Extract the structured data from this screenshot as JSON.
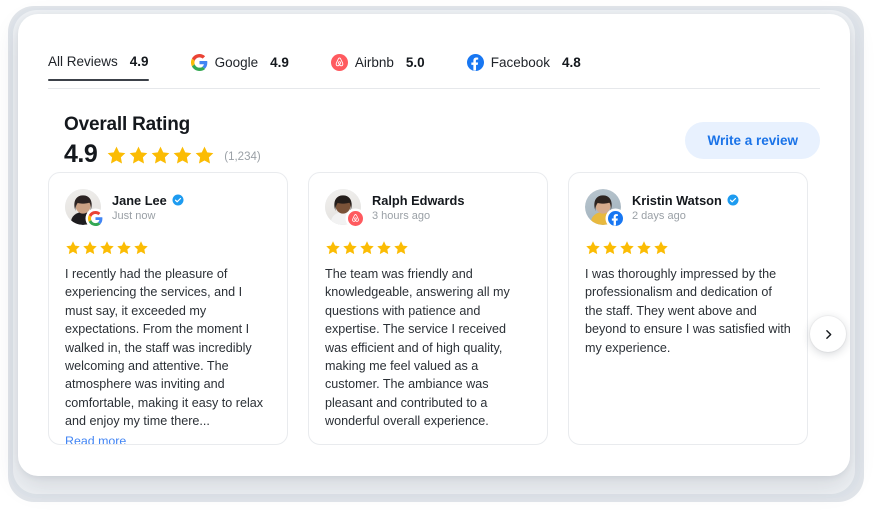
{
  "colors": {
    "accent_blue": "#1a73e8",
    "link_blue": "#4285f4",
    "star_gold": "#FBBC04",
    "airbnb_red": "#FF5A5F",
    "facebook_blue": "#1877F2",
    "verified_blue": "#1d9bf0",
    "panel_bg": "#ffffff",
    "card_border": "#e9ebee"
  },
  "tabs": [
    {
      "label": "All Reviews",
      "score": "4.9",
      "icon": "none",
      "active": true
    },
    {
      "label": "Google",
      "score": "4.9",
      "icon": "google-icon",
      "active": false
    },
    {
      "label": "Airbnb",
      "score": "5.0",
      "icon": "airbnb-icon",
      "active": false
    },
    {
      "label": "Facebook",
      "score": "4.8",
      "icon": "facebook-icon",
      "active": false
    }
  ],
  "overall": {
    "title": "Overall Rating",
    "score": "4.9",
    "stars": 5,
    "count": "(1,234)"
  },
  "write_review_button": "Write a review",
  "next_button_icon": "chevron-right-icon",
  "reviews": [
    {
      "name": "Jane Lee",
      "verified": true,
      "timestamp": "Just now",
      "source": "google-icon",
      "stars": 5,
      "text": "I recently had the pleasure of experiencing the services, and I must say, it exceeded my expectations. From the moment I walked in, the staff was incredibly welcoming and attentive. The atmosphere was inviting and comfortable, making it easy to relax and enjoy my time there...",
      "read_more": "Read more"
    },
    {
      "name": "Ralph Edwards",
      "verified": false,
      "timestamp": "3 hours ago",
      "source": "airbnb-icon",
      "stars": 5,
      "text": "The team was friendly and knowledgeable, answering all my questions with patience and expertise. The service I received was efficient and of high quality, making me feel valued as a customer. The ambiance was pleasant and contributed to a wonderful overall experience.",
      "read_more": ""
    },
    {
      "name": "Kristin Watson",
      "verified": true,
      "timestamp": "2 days ago",
      "source": "facebook-icon",
      "stars": 5,
      "text": "I was thoroughly impressed by the professionalism and dedication of the staff. They went above and beyond to ensure I was satisfied with my experience.",
      "read_more": ""
    }
  ]
}
